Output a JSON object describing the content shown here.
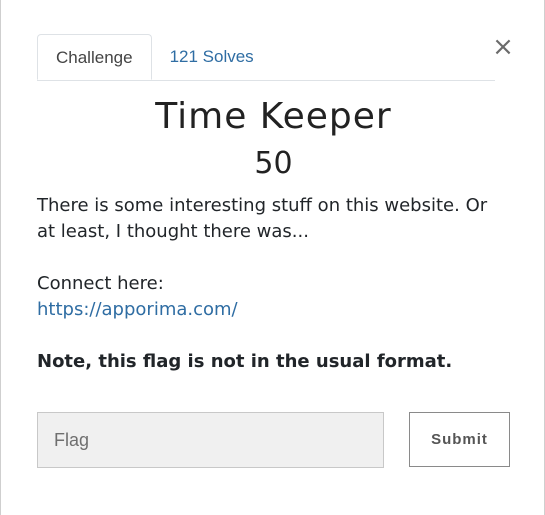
{
  "tabs": [
    {
      "label": "Challenge",
      "active": true
    },
    {
      "label": "121 Solves",
      "active": false
    }
  ],
  "close": {
    "label": "×"
  },
  "challenge": {
    "name": "Time Keeper",
    "value": "50",
    "description": [
      "There is some interesting stuff on this website. Or at least, I thought there was...",
      "Connect here:",
      "https://apporima.com/",
      "Note, this flag is not in the usual format."
    ]
  },
  "form": {
    "flag_placeholder": "Flag",
    "submit_label": "Submit"
  },
  "colors": {
    "link": "#2f6da3",
    "text": "#222222",
    "input_bg": "#f0f0f0"
  }
}
